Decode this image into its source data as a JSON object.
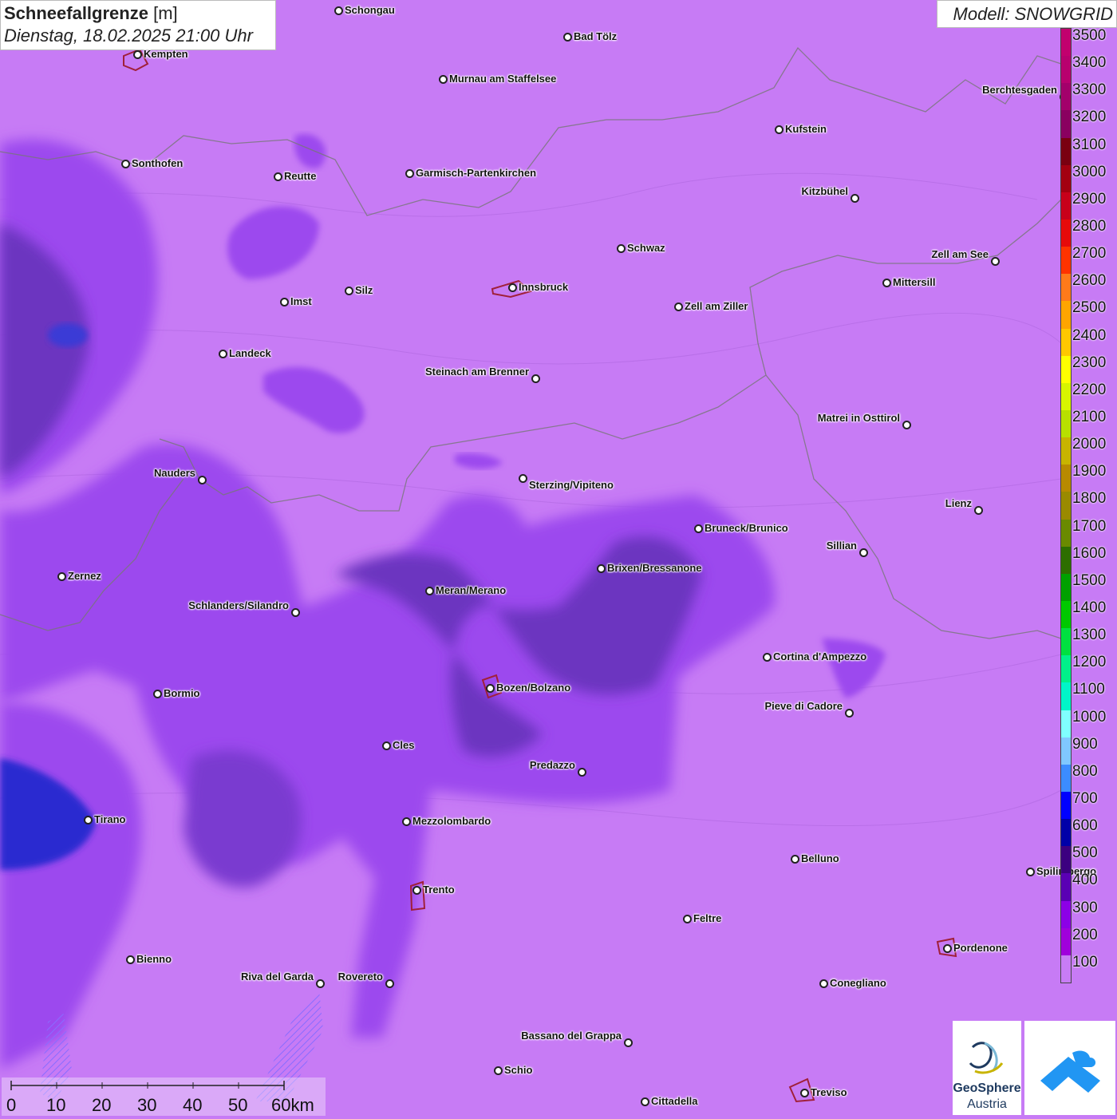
{
  "title": {
    "main": "Schneefallgrenze",
    "unit": "[m]",
    "datetime": "Dienstag, 18.02.2025 21:00 Uhr"
  },
  "model": "Modell: SNOWGRID",
  "legend": {
    "labels": [
      "3500",
      "3400",
      "3300",
      "3200",
      "3100",
      "3000",
      "2900",
      "2800",
      "2700",
      "2600",
      "2500",
      "2400",
      "2300",
      "2200",
      "2100",
      "2000",
      "1900",
      "1800",
      "1700",
      "1600",
      "1500",
      "1400",
      "1300",
      "1200",
      "1100",
      "1000",
      "900",
      "800",
      "700",
      "600",
      "500",
      "400",
      "300",
      "200",
      "100"
    ],
    "colors": [
      "#c2006e",
      "#b8006e",
      "#a3006b",
      "#8a0060",
      "#7a0010",
      "#a30010",
      "#c8001a",
      "#e60a0a",
      "#ff3300",
      "#ff7a1a",
      "#ffa500",
      "#ffc800",
      "#ffff00",
      "#d8f500",
      "#b8e000",
      "#c8b400",
      "#b88a00",
      "#9a8a00",
      "#6a8a00",
      "#2d6e00",
      "#00a000",
      "#00c800",
      "#00e040",
      "#00f08a",
      "#00f5c8",
      "#80ffff",
      "#80c8ff",
      "#3c8cff",
      "#0000ff",
      "#0000a8",
      "#3c0080",
      "#5a00b4",
      "#8c00e6",
      "#a000dc",
      "#c87cf5"
    ]
  },
  "scale": {
    "labels": [
      "0",
      "10",
      "20",
      "30",
      "40",
      "50",
      "60km"
    ]
  },
  "logo": {
    "geosphere_line1": "GeoSphere",
    "geosphere_line2": "Austria"
  },
  "cities": [
    {
      "name": "Schongau"
    },
    {
      "name": "Bad Tölz"
    },
    {
      "name": "Kempten"
    },
    {
      "name": "Murnau am Staffelsee"
    },
    {
      "name": "Berchtesgaden"
    },
    {
      "name": "Kufstein"
    },
    {
      "name": "Sonthofen"
    },
    {
      "name": "Reutte"
    },
    {
      "name": "Garmisch-Partenkirchen"
    },
    {
      "name": "Kitzbühel"
    },
    {
      "name": "Schwaz"
    },
    {
      "name": "Zell am See"
    },
    {
      "name": "Innsbruck"
    },
    {
      "name": "Mittersill"
    },
    {
      "name": "Imst"
    },
    {
      "name": "Silz"
    },
    {
      "name": "Zell am Ziller"
    },
    {
      "name": "Landeck"
    },
    {
      "name": "Steinach am Brenner"
    },
    {
      "name": "Matrei in Osttirol"
    },
    {
      "name": "Nauders"
    },
    {
      "name": "Sterzing/Vipiteno"
    },
    {
      "name": "Lienz"
    },
    {
      "name": "Bruneck/Brunico"
    },
    {
      "name": "Sillian"
    },
    {
      "name": "Zernez"
    },
    {
      "name": "Brixen/Bressanone"
    },
    {
      "name": "Meran/Merano"
    },
    {
      "name": "Schlanders/Silandro"
    },
    {
      "name": "Cortina d'Ampezzo"
    },
    {
      "name": "Bozen/Bolzano"
    },
    {
      "name": "Bormio"
    },
    {
      "name": "Pieve di Cadore"
    },
    {
      "name": "Cles"
    },
    {
      "name": "Predazzo"
    },
    {
      "name": "Tirano"
    },
    {
      "name": "Mezzolombardo"
    },
    {
      "name": "Belluno"
    },
    {
      "name": "Spilimbergo"
    },
    {
      "name": "Trento"
    },
    {
      "name": "Feltre"
    },
    {
      "name": "Pordenone"
    },
    {
      "name": "Bienno"
    },
    {
      "name": "Riva del Garda"
    },
    {
      "name": "Rovereto"
    },
    {
      "name": "Conegliano"
    },
    {
      "name": "Bassano del Grappa"
    },
    {
      "name": "Schio"
    },
    {
      "name": "Treviso"
    },
    {
      "name": "Cittadella"
    }
  ]
}
